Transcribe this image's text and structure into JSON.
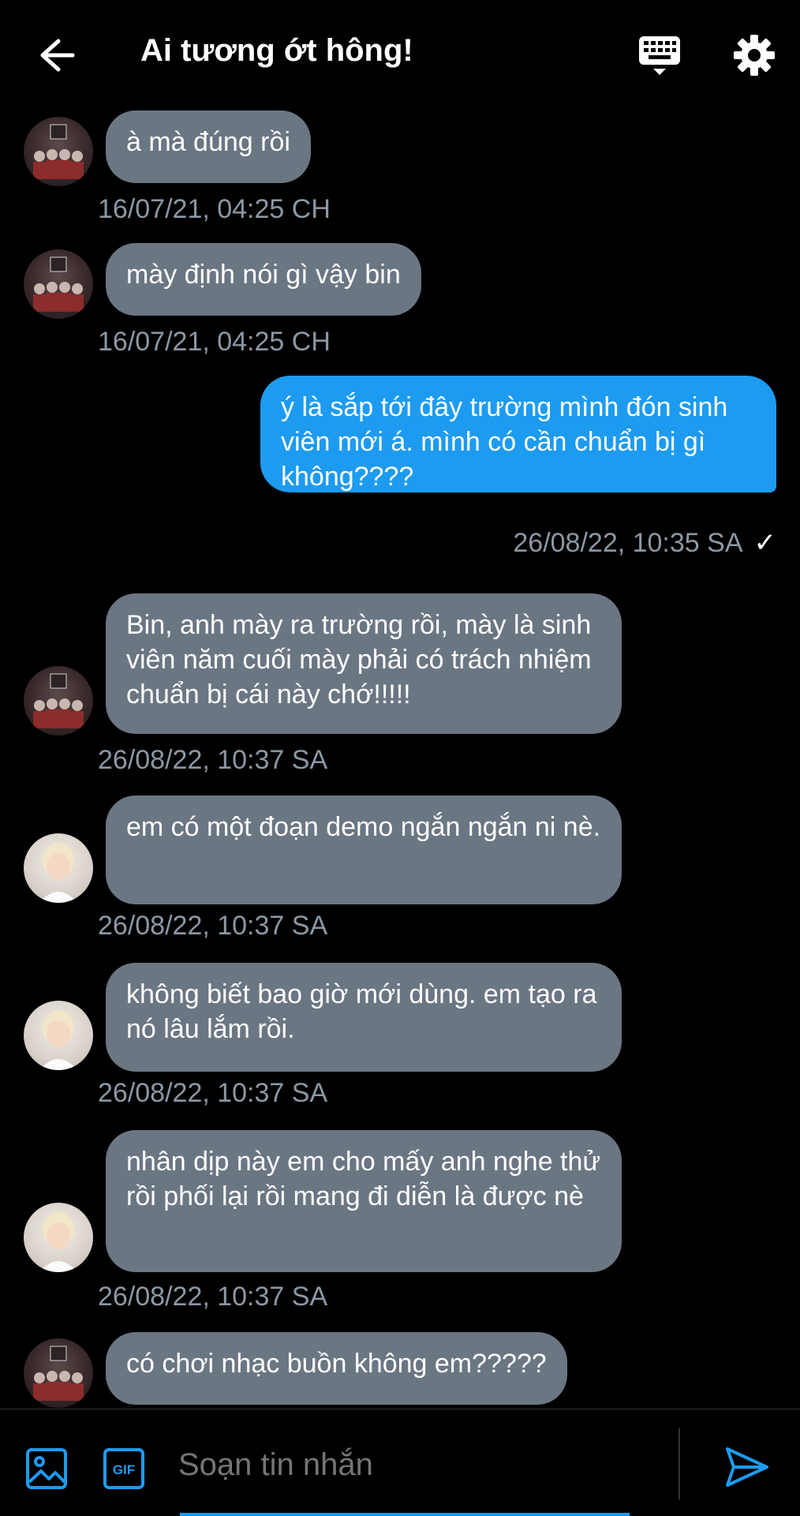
{
  "header": {
    "title": "Ai tương ớt hông!",
    "back_icon": "arrow-left-icon",
    "keyboard_icon": "keyboard-icon",
    "settings_icon": "gear-icon"
  },
  "messages": [
    {
      "sender": "them",
      "avatar": "group-avatar",
      "text": "à mà đúng rồi",
      "time": "16/07/21, 04:25 CH"
    },
    {
      "sender": "them",
      "avatar": "group-avatar",
      "text": "mày định nói gì vậy bin",
      "time": "16/07/21, 04:25 CH"
    },
    {
      "sender": "me",
      "text": "ý là sắp tới đây trường mình đón sinh viên mới á. mình có cần chuẩn bị gì không????",
      "time": "26/08/22, 10:35 SA",
      "status": "✓"
    },
    {
      "sender": "them",
      "avatar": "group-avatar",
      "text": "Bin, anh mày ra trường rồi, mày là sinh viên năm cuối mày phải có trách nhiệm chuẩn bị cái này chớ!!!!!",
      "time": "26/08/22, 10:37 SA"
    },
    {
      "sender": "them",
      "avatar": "person-avatar",
      "text": "em có một đoạn demo ngắn ngắn ni nè.",
      "time": "26/08/22, 10:37 SA"
    },
    {
      "sender": "them",
      "avatar": "person-avatar",
      "text": "không biết bao giờ mới dùng. em tạo ra nó lâu lắm rồi.",
      "time": "26/08/22, 10:37 SA"
    },
    {
      "sender": "them",
      "avatar": "person-avatar",
      "text": "nhân dịp này em cho mấy anh nghe thử rồi phối lại rồi mang đi diễn là được nè",
      "time": "26/08/22, 10:37 SA"
    },
    {
      "sender": "them",
      "avatar": "group-avatar",
      "text": "có chơi nhạc buồn không em?????"
    }
  ],
  "composer": {
    "placeholder": "Soạn tin nhắn",
    "media_icon": "image-icon",
    "gif_icon": "gif-icon",
    "send_icon": "send-icon",
    "gif_label": "GIF"
  },
  "colors": {
    "background": "#000000",
    "incoming_bubble": "#6b7683",
    "outgoing_bubble": "#1d9bf0",
    "accent": "#1d9bf0",
    "timestamp": "#8b98a5"
  }
}
